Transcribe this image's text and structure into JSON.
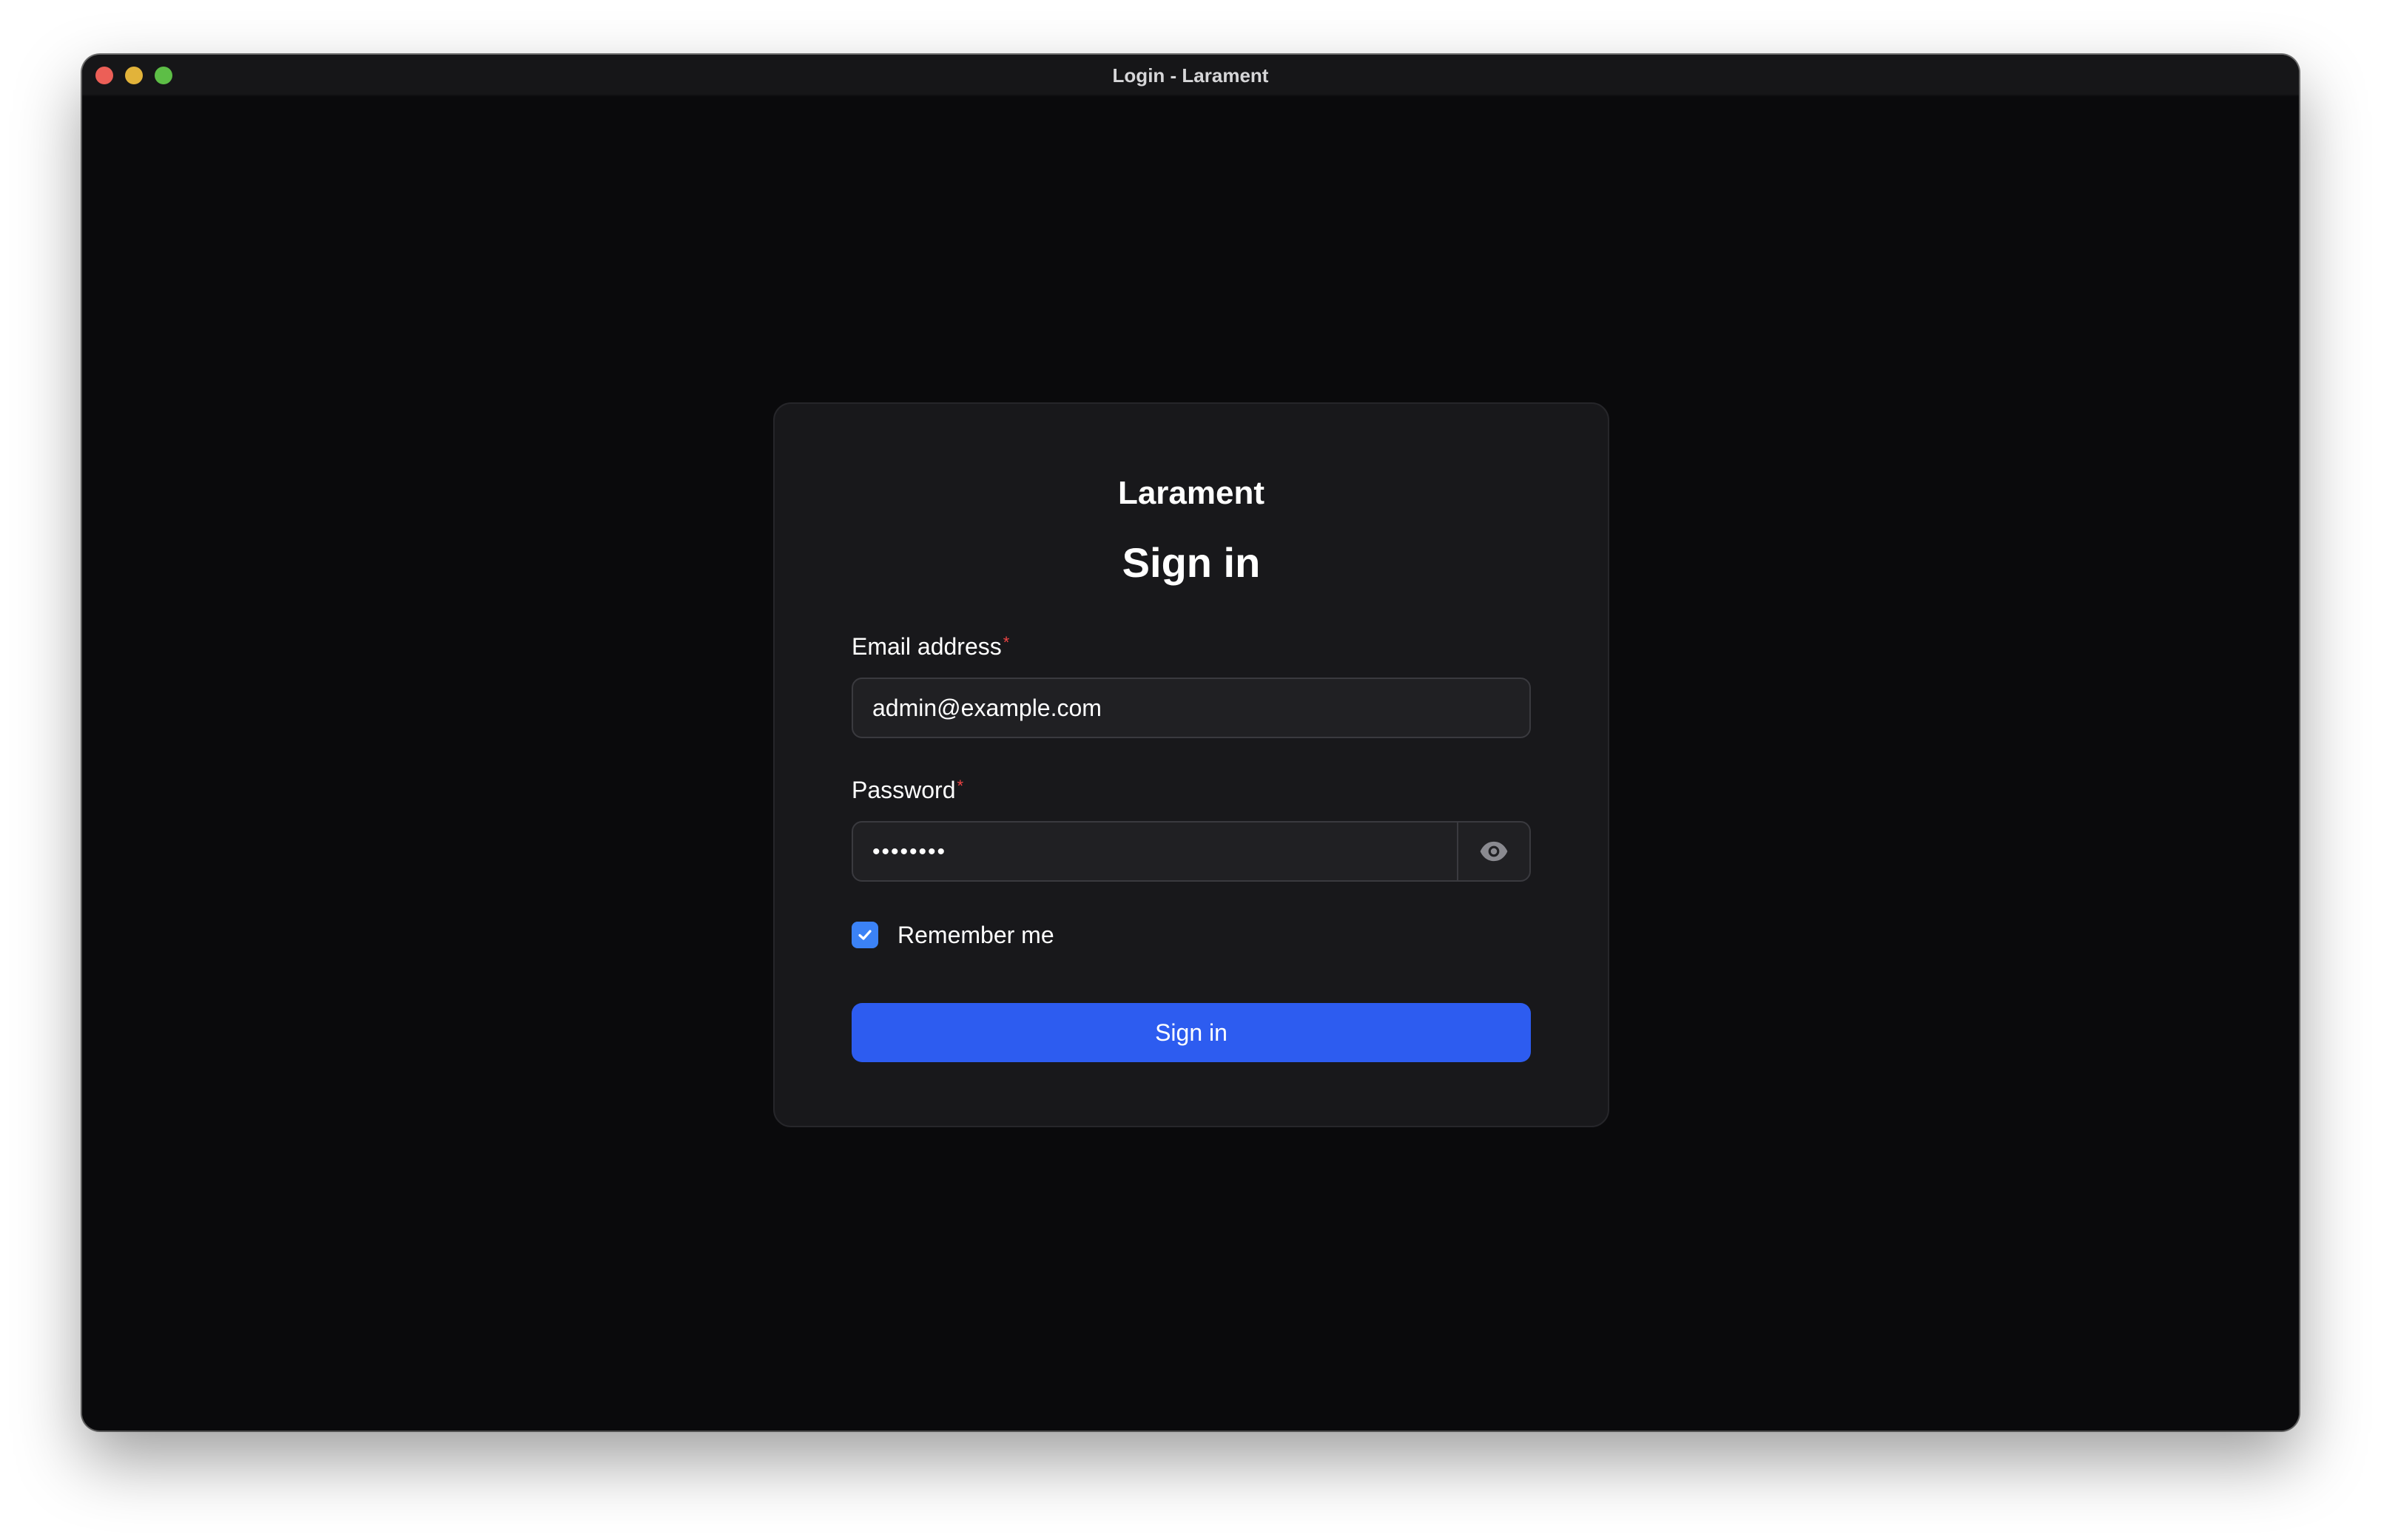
{
  "window": {
    "title": "Login - Larament"
  },
  "login": {
    "brand": "Larament",
    "heading": "Sign in",
    "email": {
      "label": "Email address",
      "required_mark": "*",
      "value": "admin@example.com"
    },
    "password": {
      "label": "Password",
      "required_mark": "*",
      "masked_value": "••••••••",
      "toggle_icon": "eye-icon"
    },
    "remember": {
      "label": "Remember me",
      "checked": true
    },
    "submit_label": "Sign in"
  },
  "colors": {
    "accent": "#2d5cf0",
    "checkbox": "#3b82f6",
    "required": "#ef4444",
    "window_bg": "#0a0a0c",
    "card_bg": "#18181b"
  }
}
